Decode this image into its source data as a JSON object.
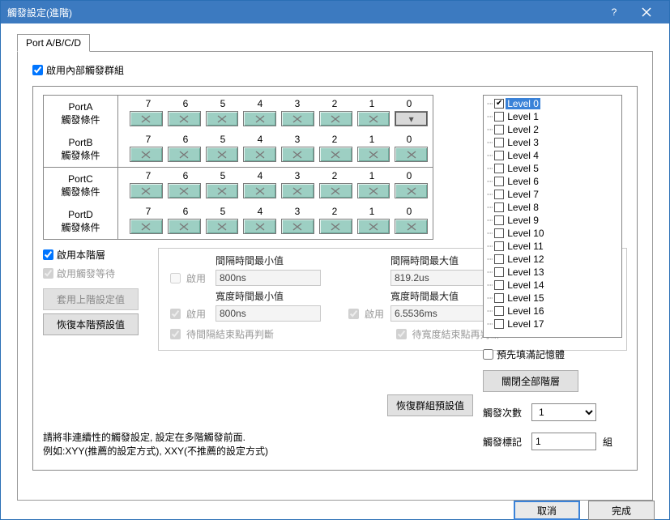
{
  "window": {
    "title": "觸發設定(進階)"
  },
  "tab": {
    "label": "Port A/B/C/D"
  },
  "enable_group": {
    "label": "啟用內部觸發群組",
    "checked": true
  },
  "bit_headers": [
    "7",
    "6",
    "5",
    "4",
    "3",
    "2",
    "1",
    "0"
  ],
  "ports": [
    {
      "name": "PortA",
      "cond": "觸發條件"
    },
    {
      "name": "PortB",
      "cond": "觸發條件"
    },
    {
      "name": "PortC",
      "cond": "觸發條件"
    },
    {
      "name": "PortD",
      "cond": "觸發條件"
    }
  ],
  "layer": {
    "enable_layer": "啟用本階層",
    "enable_wait": "啟用觸發等待",
    "apply_prev": "套用上階設定值",
    "restore_layer": "恢復本階預設值"
  },
  "timing": {
    "enable": "啟用",
    "interval_min_label": "間隔時間最小值",
    "interval_min": "800ns",
    "interval_max_label": "間隔時間最大值",
    "interval_max": "819.2us",
    "width_min_label": "寬度時間最小值",
    "width_min": "800ns",
    "width_max_label": "寬度時間最大值",
    "width_max": "6.5536ms",
    "wait_interval_end": "待間隔結束點再判斷",
    "wait_width_end": "待寬度結束點再判斷"
  },
  "restore_group_default": "恢復群組預設值",
  "note_line1": "請將非連續性的觸發設定, 設定在多階觸發前面.",
  "note_line2": "例如:XYY(推薦的設定方式), XXY(不推薦的設定方式)",
  "levels": [
    "Level 0",
    "Level 1",
    "Level 2",
    "Level 3",
    "Level 4",
    "Level 5",
    "Level 6",
    "Level 7",
    "Level 8",
    "Level 9",
    "Level 10",
    "Level 11",
    "Level 12",
    "Level 13",
    "Level 14",
    "Level 15",
    "Level 16",
    "Level 17"
  ],
  "level_selected_index": 0,
  "prefill_mem": "預先填滿記憶體",
  "close_all_layers": "關閉全部階層",
  "trigger_count_label": "觸發次數",
  "trigger_count_value": "1",
  "trigger_mark_label": "觸發標記",
  "trigger_mark_value": "1",
  "trigger_mark_unit": "組",
  "buttons": {
    "cancel": "取消",
    "ok": "完成"
  }
}
